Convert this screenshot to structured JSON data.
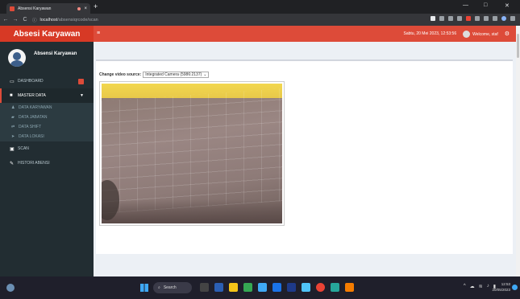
{
  "browser": {
    "tab_title": "Absensi Karyawan",
    "tab_close": "×",
    "new_tab": "+",
    "url_host": "localhost",
    "url_path": "/absensiqrcode/scan",
    "nav_back": "←",
    "nav_forward": "→",
    "nav_reload": "C",
    "win_min": "—",
    "win_max": "□",
    "win_close": "✕"
  },
  "header": {
    "app_title": "Absesi Karyawan",
    "hamburger": "≡",
    "datetime": "Sabtu, 20 Mei 2023, 12:53:56",
    "welcome": "Welcome, staf"
  },
  "sidebar": {
    "user_name": "Absensi Karyawan",
    "items": [
      {
        "label": "DASHBOARD",
        "icon": "monitor-icon"
      },
      {
        "label": "MASTER DATA",
        "icon": "folder-icon"
      }
    ],
    "submenu": [
      {
        "label": "DATA KARYAWAN",
        "icon": "user-icon"
      },
      {
        "label": "DATA JABATAN",
        "icon": "car-icon"
      },
      {
        "label": "DATA SHIFT",
        "icon": "exchange-icon"
      },
      {
        "label": "DATA LOKASI",
        "icon": "location-icon"
      }
    ],
    "bottom_items": [
      {
        "label": "SCAN",
        "icon": "camera-icon"
      },
      {
        "label": "HISTORI ABENSI",
        "icon": "pen-icon"
      }
    ]
  },
  "main": {
    "source_label": "Change video source:",
    "source_value": "Integrated Camera (5986:2137)"
  },
  "taskbar": {
    "search_placeholder": "Search",
    "time": "12:53",
    "date": "20/05/2023"
  },
  "colors": {
    "accent": "#dd4b39",
    "sidebar_bg": "#222d32",
    "content_bg": "#ecf0f5"
  }
}
